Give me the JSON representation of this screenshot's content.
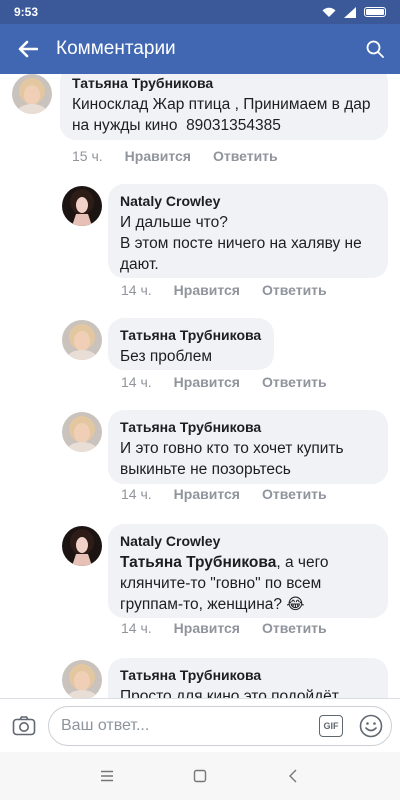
{
  "status_bar": {
    "time": "9:53"
  },
  "app_bar": {
    "title": "Комментарии"
  },
  "comments": [
    {
      "author": "Татьяна Трубникова",
      "text": "Киносклад Жар птица , Принимаем в дар на нужды кино  89031354385",
      "time": "15 ч.",
      "like": "Нравится",
      "reply": "Ответить"
    },
    {
      "author": "Nataly Crowley",
      "text": "И дальше что?\nВ этом посте ничего на халяву не дают.",
      "time": "14 ч.",
      "like": "Нравится",
      "reply": "Ответить"
    },
    {
      "author": "Татьяна Трубникова",
      "text": "Без проблем",
      "time": "14 ч.",
      "like": "Нравится",
      "reply": "Ответить"
    },
    {
      "author": "Татьяна Трубникова",
      "text": "И это говно кто то хочет купить выкиньте не позорьтесь",
      "time": "14 ч.",
      "like": "Нравится",
      "reply": "Ответить"
    },
    {
      "author": "Nataly Crowley",
      "mention": "Татьяна Трубникова",
      "text": ", а чего клянчите-то \"говно\" по всем группам-то, женщина? 😂",
      "time": "14 ч.",
      "like": "Нравится",
      "reply": "Ответить"
    },
    {
      "author": "Татьяна Трубникова",
      "text": "Просто для кино это подойдёт"
    }
  ],
  "composer": {
    "placeholder": "Ваш ответ...",
    "gif_label": "GIF"
  },
  "icons": {
    "back": "back-arrow-icon",
    "search": "search-icon",
    "camera": "camera-icon",
    "gif": "gif-icon",
    "emoji": "emoji-icon",
    "menu": "menu-icon",
    "home": "home-icon",
    "nav_back": "nav-back-icon"
  },
  "colors": {
    "status_bar": "#3b5998",
    "app_bar": "#4267b2",
    "bubble": "#f0f2f5",
    "meta_text": "#90949c"
  }
}
